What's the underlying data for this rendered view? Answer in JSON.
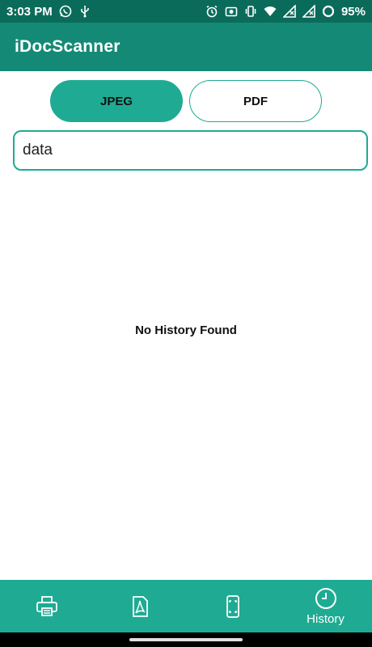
{
  "status_bar": {
    "time": "3:03 PM",
    "battery": "95%",
    "icons_left": [
      "whatsapp-icon",
      "usb-icon"
    ],
    "icons_right": [
      "alarm-icon",
      "screenshot-icon",
      "vibrate-icon",
      "wifi-icon",
      "signal-icon",
      "signal-icon",
      "battery-icon"
    ]
  },
  "app_bar": {
    "title": "iDocScanner"
  },
  "format_toggle": {
    "options": [
      {
        "label": "JPEG",
        "selected": true
      },
      {
        "label": "PDF",
        "selected": false
      }
    ]
  },
  "search": {
    "value": "data"
  },
  "history": {
    "empty_message": "No History Found"
  },
  "bottom_nav": {
    "items": [
      {
        "icon": "printer-icon",
        "label": ""
      },
      {
        "icon": "pdf-icon",
        "label": ""
      },
      {
        "icon": "scan-phone-icon",
        "label": ""
      },
      {
        "icon": "clock-icon",
        "label": "History",
        "active": true
      }
    ]
  },
  "colors": {
    "status_bar": "#0b6b5b",
    "app_bar": "#148a76",
    "accent": "#1fab93",
    "background": "#ffffff"
  }
}
